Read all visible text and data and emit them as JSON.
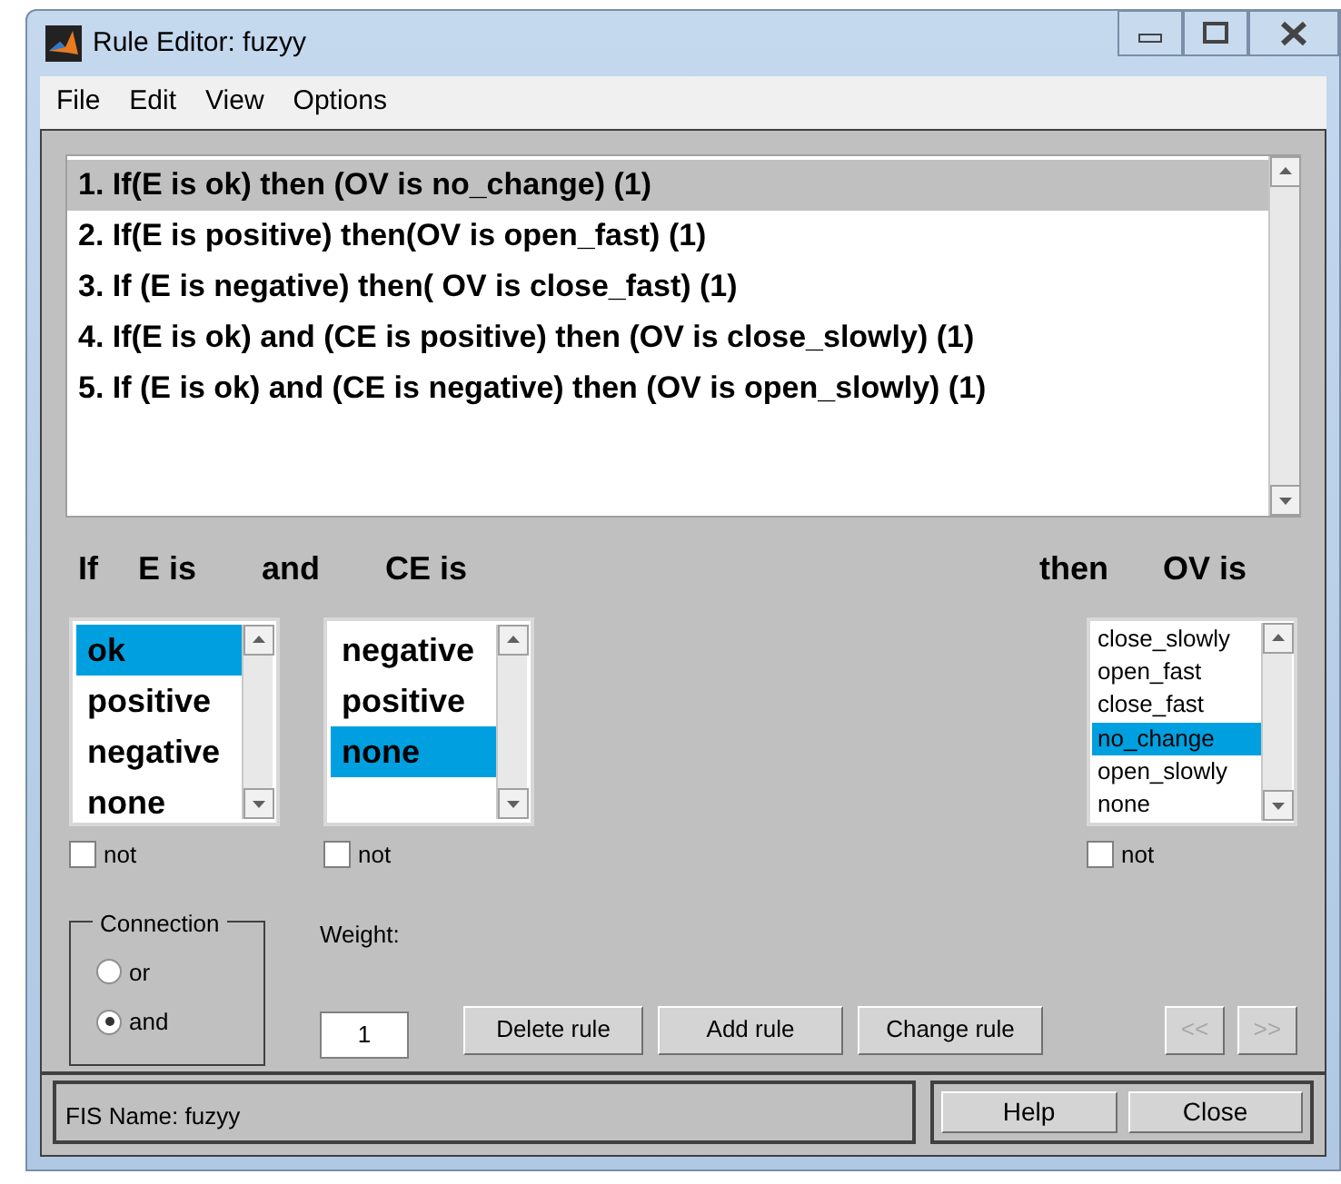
{
  "window": {
    "title": "Rule Editor: fuzyy"
  },
  "menu": [
    "File",
    "Edit",
    "View",
    "Options"
  ],
  "rules": [
    {
      "text": "1. If(E is ok) then (OV is no_change) (1)",
      "selected": true
    },
    {
      "text": "2. If(E is positive) then(OV is open_fast) (1)",
      "selected": false
    },
    {
      "text": "3. If (E is negative) then( OV is close_fast) (1)",
      "selected": false
    },
    {
      "text": "4. If(E is ok) and (CE is positive) then (OV is close_slowly) (1)",
      "selected": false
    },
    {
      "text": "5. If (E is ok) and (CE is negative) then (OV is open_slowly) (1)",
      "selected": false
    }
  ],
  "antecedents": [
    {
      "prefix": "If",
      "label": "E is",
      "not": false,
      "not_label": "not",
      "items": [
        {
          "text": "ok",
          "selected": true
        },
        {
          "text": "positive",
          "selected": false
        },
        {
          "text": "negative",
          "selected": false
        },
        {
          "text": "none",
          "selected": false
        }
      ]
    },
    {
      "prefix": "and",
      "label": "CE is",
      "not": false,
      "not_label": "not",
      "items": [
        {
          "text": "negative",
          "selected": false
        },
        {
          "text": "positive",
          "selected": false
        },
        {
          "text": "none",
          "selected": true
        }
      ]
    }
  ],
  "consequent": {
    "prefix": "then",
    "label": "OV is",
    "not": false,
    "not_label": "not",
    "items": [
      {
        "text": "close_slowly",
        "selected": false
      },
      {
        "text": "open_fast",
        "selected": false
      },
      {
        "text": "close_fast",
        "selected": false
      },
      {
        "text": "no_change",
        "selected": true
      },
      {
        "text": "open_slowly",
        "selected": false
      },
      {
        "text": "none",
        "selected": false
      }
    ]
  },
  "connection": {
    "title": "Connection",
    "options": [
      {
        "label": "or",
        "selected": false
      },
      {
        "label": "and",
        "selected": true
      }
    ]
  },
  "weight": {
    "label": "Weight:",
    "value": "1"
  },
  "buttons": [
    {
      "label": "Delete rule",
      "disabled": false
    },
    {
      "label": "Add rule",
      "disabled": false
    },
    {
      "label": "Change rule",
      "disabled": false
    }
  ],
  "nav_buttons": [
    {
      "label": "<<",
      "disabled": true
    },
    {
      "label": ">>",
      "disabled": true
    }
  ],
  "status": "FIS Name: fuzyy",
  "footer_buttons": [
    "Help",
    "Close"
  ]
}
